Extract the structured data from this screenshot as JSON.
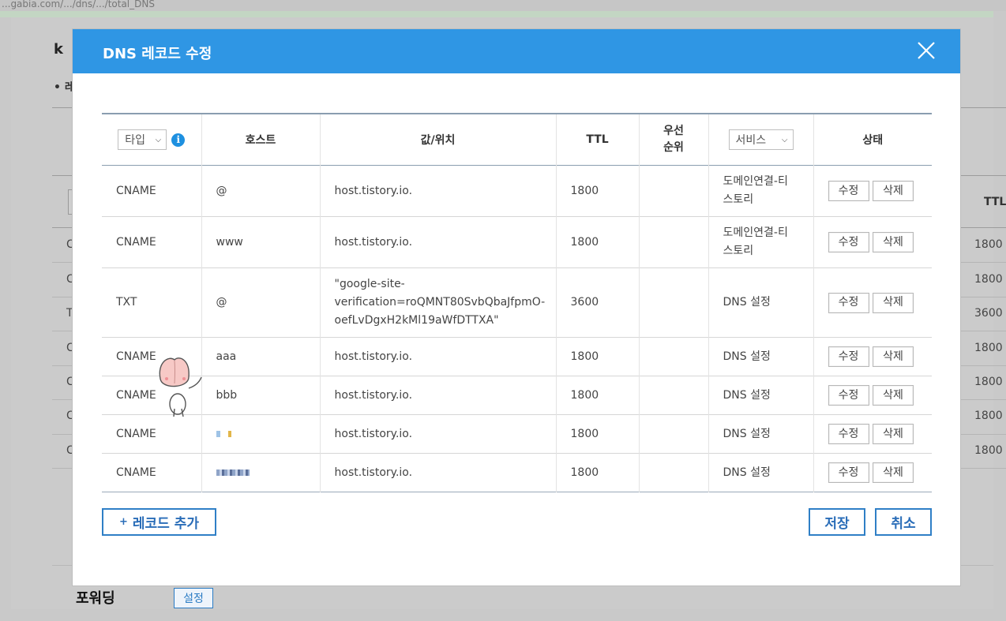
{
  "background": {
    "url_fragment": "...gabia.com/.../dns/.../total_DNS",
    "logo": "k",
    "bullet": "• 레",
    "ttl_header": "TTL",
    "ttl_values": [
      "1800",
      "1800",
      "3600",
      "1800",
      "1800",
      "1800",
      "1800"
    ],
    "left_letters": [
      "C",
      "C",
      "T",
      "C",
      "C",
      "C",
      "C"
    ],
    "forwarding_label": "포워딩",
    "forwarding_button": "설정"
  },
  "modal": {
    "title": "DNS 레코드 수정",
    "close_icon": "close-icon",
    "columns": {
      "type_select": "타입",
      "host": "호스트",
      "value": "값/위치",
      "ttl": "TTL",
      "priority_line1": "우선",
      "priority_line2": "순위",
      "service_select": "서비스",
      "status": "상태"
    },
    "records": [
      {
        "type": "CNAME",
        "host": "@",
        "value": "host.tistory.io.",
        "ttl": "1800",
        "priority": "",
        "service_line1": "도메인연결-티",
        "service_line2": "스토리",
        "edit": "수정",
        "delete": "삭제"
      },
      {
        "type": "CNAME",
        "host": "www",
        "value": "host.tistory.io.",
        "ttl": "1800",
        "priority": "",
        "service_line1": "도메인연결-티",
        "service_line2": "스토리",
        "edit": "수정",
        "delete": "삭제"
      },
      {
        "type": "TXT",
        "host": "@",
        "value_line1": "\"google-site-",
        "value_line2": "verification=roQMNT80SvbQbaJfpmO-",
        "value_line3": "oefLvDgxH2kMl19aWfDTTXA\"",
        "ttl": "3600",
        "priority": "",
        "service": "DNS 설정",
        "edit": "수정",
        "delete": "삭제"
      },
      {
        "type": "CNAME",
        "host": "aaa",
        "value": "host.tistory.io.",
        "ttl": "1800",
        "priority": "",
        "service": "DNS 설정",
        "edit": "수정",
        "delete": "삭제"
      },
      {
        "type": "CNAME",
        "host": "bbb",
        "value": "host.tistory.io.",
        "ttl": "1800",
        "priority": "",
        "service": "DNS 설정",
        "edit": "수정",
        "delete": "삭제"
      },
      {
        "type": "CNAME",
        "host": "",
        "value": "host.tistory.io.",
        "ttl": "1800",
        "priority": "",
        "service": "DNS 설정",
        "edit": "수정",
        "delete": "삭제"
      },
      {
        "type": "CNAME",
        "host": "",
        "value": "host.tistory.io.",
        "ttl": "1800",
        "priority": "",
        "service": "DNS 설정",
        "edit": "수정",
        "delete": "삭제"
      }
    ],
    "add_record": "레코드 추가",
    "add_plus": "+",
    "save": "저장",
    "cancel": "취소"
  },
  "colors": {
    "header_blue": "#2f96e4",
    "button_blue": "#2f7fc6",
    "info_blue": "#1e90e0"
  }
}
